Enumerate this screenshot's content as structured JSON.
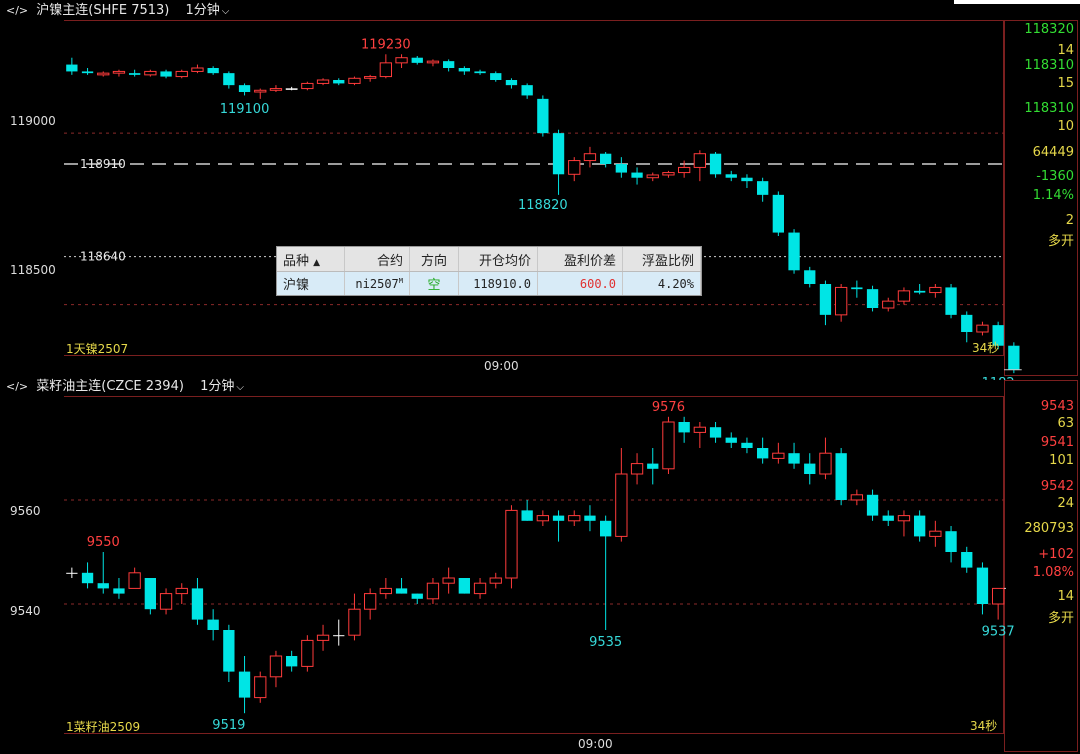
{
  "colors": {
    "up": "#ff3b3b",
    "down": "#00e5e5",
    "flat": "#ffffff",
    "frame": "#7a1f1f",
    "grid": "#8b2a2a",
    "label_red": "#ff4040",
    "label_cyan": "#36d9d9",
    "yellow": "#e6d84a",
    "green": "#33dd33"
  },
  "panel1": {
    "title": "沪镍主连(SHFE 7513)",
    "timeframe": "1分钟",
    "y_labels": [
      "119000",
      "118500"
    ],
    "ref_lines": [
      {
        "label": "118910",
        "value": 118910,
        "style": "dashed"
      },
      {
        "label": "118640",
        "value": 118640,
        "style": "dotted"
      }
    ],
    "annotations": [
      {
        "text": "119230",
        "value": 119230,
        "index": 20,
        "color": "red"
      },
      {
        "text": "119100",
        "value": 119100,
        "index": 11,
        "color": "cyan"
      },
      {
        "text": "118820",
        "value": 118820,
        "index": 30,
        "color": "cyan"
      },
      {
        "text": "1182",
        "value": 118300,
        "index": 59,
        "color": "cyan"
      }
    ],
    "time_label": "09:00",
    "bottom_left": "1天镍2507",
    "bottom_right": "34秒",
    "stats": [
      {
        "text": "118320",
        "color": "green"
      },
      {
        "text": "14",
        "color": "yellow"
      },
      {
        "text": "118310",
        "color": "green"
      },
      {
        "text": "15",
        "color": "yellow"
      },
      {
        "text": "118310",
        "color": "green"
      },
      {
        "text": "10",
        "color": "yellow"
      },
      {
        "text": "64449",
        "color": "yellow"
      },
      {
        "text": "-1360",
        "color": "green"
      },
      {
        "text": "1.14%",
        "color": "green"
      },
      {
        "text": "2",
        "color": "yellow"
      },
      {
        "text": "多开",
        "color": "yellow"
      }
    ]
  },
  "panel2": {
    "title": "菜籽油主连(CZCE 2394)",
    "timeframe": "1分钟",
    "y_labels": [
      "9560",
      "9540"
    ],
    "annotations": [
      {
        "text": "9550",
        "value": 9550,
        "index": 2,
        "color": "red"
      },
      {
        "text": "9576",
        "value": 9576,
        "index": 38,
        "color": "red"
      },
      {
        "text": "9519",
        "value": 9519,
        "index": 10,
        "color": "cyan"
      },
      {
        "text": "9535",
        "value": 9535,
        "index": 34,
        "color": "cyan"
      },
      {
        "text": "9537",
        "value": 9537,
        "index": 59,
        "color": "cyan"
      }
    ],
    "time_label": "09:00",
    "bottom_left": "1菜籽油2509",
    "bottom_right": "34秒",
    "stats": [
      {
        "text": "9543",
        "color": "red"
      },
      {
        "text": "63",
        "color": "yellow"
      },
      {
        "text": "9541",
        "color": "red"
      },
      {
        "text": "101",
        "color": "yellow"
      },
      {
        "text": "9542",
        "color": "red"
      },
      {
        "text": "24",
        "color": "yellow"
      },
      {
        "text": "280793",
        "color": "yellow"
      },
      {
        "text": "+102",
        "color": "red"
      },
      {
        "text": "1.08%",
        "color": "red"
      },
      {
        "text": "14",
        "color": "yellow"
      },
      {
        "text": "多开",
        "color": "yellow"
      }
    ]
  },
  "position_table": {
    "headers": [
      "品种",
      "合约",
      "方向",
      "开仓均价",
      "盈利价差",
      "浮盈比例"
    ],
    "sort_indicator": "▲",
    "row": {
      "variety": "沪镍",
      "contract": "ni2507",
      "contract_sup": "M",
      "direction": "空",
      "open_avg": "118910.0",
      "profit_diff": "600.0",
      "float_ratio": "4.20%"
    }
  },
  "chart_data": [
    {
      "type": "candlestick",
      "title": "沪镍主连(SHFE 7513)",
      "ylim": [
        118350,
        119330
      ],
      "y_ticks": [
        119000,
        118500
      ],
      "x_label": "09:00",
      "ohlc": [
        [
          119200,
          119220,
          119170,
          119180
        ],
        [
          119180,
          119190,
          119170,
          119175
        ],
        [
          119170,
          119180,
          119165,
          119175
        ],
        [
          119175,
          119185,
          119165,
          119180
        ],
        [
          119175,
          119185,
          119165,
          119170
        ],
        [
          119170,
          119185,
          119165,
          119180
        ],
        [
          119180,
          119185,
          119160,
          119165
        ],
        [
          119165,
          119185,
          119160,
          119180
        ],
        [
          119180,
          119200,
          119175,
          119190
        ],
        [
          119190,
          119195,
          119170,
          119175
        ],
        [
          119175,
          119180,
          119130,
          119140
        ],
        [
          119140,
          119145,
          119110,
          119120
        ],
        [
          119120,
          119130,
          119100,
          119125
        ],
        [
          119125,
          119140,
          119120,
          119130
        ],
        [
          119130,
          119135,
          119125,
          119130
        ],
        [
          119130,
          119150,
          119125,
          119145
        ],
        [
          119145,
          119160,
          119140,
          119155
        ],
        [
          119155,
          119160,
          119140,
          119145
        ],
        [
          119145,
          119165,
          119140,
          119160
        ],
        [
          119160,
          119170,
          119150,
          119165
        ],
        [
          119165,
          119230,
          119160,
          119205
        ],
        [
          119205,
          119230,
          119190,
          119220
        ],
        [
          119220,
          119225,
          119200,
          119205
        ],
        [
          119205,
          119215,
          119195,
          119210
        ],
        [
          119210,
          119215,
          119180,
          119190
        ],
        [
          119190,
          119195,
          119170,
          119180
        ],
        [
          119180,
          119185,
          119170,
          119175
        ],
        [
          119175,
          119180,
          119150,
          119155
        ],
        [
          119155,
          119160,
          119130,
          119140
        ],
        [
          119140,
          119145,
          119100,
          119110
        ],
        [
          119100,
          119110,
          118990,
          119000
        ],
        [
          119000,
          119010,
          118820,
          118880
        ],
        [
          118880,
          118930,
          118860,
          118920
        ],
        [
          118920,
          118960,
          118900,
          118940
        ],
        [
          118940,
          118945,
          118900,
          118910
        ],
        [
          118910,
          118930,
          118870,
          118885
        ],
        [
          118885,
          118900,
          118850,
          118870
        ],
        [
          118870,
          118885,
          118860,
          118878
        ],
        [
          118878,
          118890,
          118870,
          118885
        ],
        [
          118885,
          118920,
          118870,
          118900
        ],
        [
          118900,
          118950,
          118860,
          118940
        ],
        [
          118940,
          118945,
          118870,
          118880
        ],
        [
          118880,
          118890,
          118860,
          118870
        ],
        [
          118870,
          118880,
          118840,
          118860
        ],
        [
          118860,
          118870,
          118800,
          118820
        ],
        [
          118820,
          118830,
          118700,
          118710
        ],
        [
          118710,
          118720,
          118590,
          118600
        ],
        [
          118600,
          118610,
          118550,
          118560
        ],
        [
          118560,
          118570,
          118440,
          118470
        ],
        [
          118470,
          118560,
          118450,
          118550
        ],
        [
          118550,
          118570,
          118520,
          118545
        ],
        [
          118545,
          118555,
          118480,
          118490
        ],
        [
          118490,
          118520,
          118480,
          118510
        ],
        [
          118510,
          118550,
          118500,
          118540
        ],
        [
          118540,
          118560,
          118530,
          118535
        ],
        [
          118535,
          118560,
          118520,
          118550
        ],
        [
          118550,
          118560,
          118460,
          118470
        ],
        [
          118470,
          118480,
          118390,
          118420
        ],
        [
          118420,
          118450,
          118410,
          118440
        ],
        [
          118440,
          118450,
          118370,
          118380
        ],
        [
          118380,
          118390,
          118300,
          118310
        ]
      ]
    },
    {
      "type": "candlestick",
      "title": "菜籽油主连(CZCE 2394)",
      "ylim": [
        9515,
        9580
      ],
      "y_ticks": [
        9560,
        9540
      ],
      "x_label": "09:00",
      "ohlc": [
        [
          9546,
          9547,
          9545,
          9546
        ],
        [
          9546,
          9548,
          9543,
          9544
        ],
        [
          9544,
          9550,
          9542,
          9543
        ],
        [
          9543,
          9545,
          9541,
          9542
        ],
        [
          9543,
          9547,
          9543,
          9546
        ],
        [
          9545,
          9545,
          9538,
          9539
        ],
        [
          9539,
          9543,
          9538,
          9542
        ],
        [
          9542,
          9544,
          9540,
          9543
        ],
        [
          9543,
          9545,
          9536,
          9537
        ],
        [
          9537,
          9539,
          9533,
          9535
        ],
        [
          9535,
          9536,
          9525,
          9527
        ],
        [
          9527,
          9530,
          9519,
          9522
        ],
        [
          9522,
          9527,
          9521,
          9526
        ],
        [
          9526,
          9531,
          9524,
          9530
        ],
        [
          9530,
          9531,
          9527,
          9528
        ],
        [
          9528,
          9534,
          9527,
          9533
        ],
        [
          9533,
          9536,
          9531,
          9534
        ],
        [
          9534,
          9537,
          9532,
          9534
        ],
        [
          9534,
          9542,
          9533,
          9539
        ],
        [
          9539,
          9543,
          9537,
          9542
        ],
        [
          9542,
          9545,
          9541,
          9543
        ],
        [
          9543,
          9545,
          9542,
          9542
        ],
        [
          9542,
          9542,
          9540,
          9541
        ],
        [
          9541,
          9545,
          9540,
          9544
        ],
        [
          9544,
          9547,
          9542,
          9545
        ],
        [
          9545,
          9545,
          9542,
          9542
        ],
        [
          9542,
          9545,
          9541,
          9544
        ],
        [
          9544,
          9546,
          9543,
          9545
        ],
        [
          9545,
          9559,
          9543,
          9558
        ],
        [
          9558,
          9560,
          9556,
          9556
        ],
        [
          9556,
          9558,
          9555,
          9557
        ],
        [
          9557,
          9558,
          9552,
          9556
        ],
        [
          9556,
          9558,
          9555,
          9557
        ],
        [
          9557,
          9559,
          9554,
          9556
        ],
        [
          9556,
          9557,
          9535,
          9553
        ],
        [
          9553,
          9570,
          9552,
          9565
        ],
        [
          9565,
          9569,
          9563,
          9567
        ],
        [
          9567,
          9570,
          9563,
          9566
        ],
        [
          9566,
          9576,
          9565,
          9575
        ],
        [
          9575,
          9576,
          9571,
          9573
        ],
        [
          9573,
          9575,
          9570,
          9574
        ],
        [
          9574,
          9575,
          9571,
          9572
        ],
        [
          9572,
          9573,
          9570,
          9571
        ],
        [
          9571,
          9572,
          9569,
          9570
        ],
        [
          9570,
          9572,
          9567,
          9568
        ],
        [
          9568,
          9571,
          9567,
          9569
        ],
        [
          9569,
          9571,
          9566,
          9567
        ],
        [
          9567,
          9569,
          9563,
          9565
        ],
        [
          9565,
          9572,
          9564,
          9569
        ],
        [
          9569,
          9570,
          9559,
          9560
        ],
        [
          9560,
          9562,
          9559,
          9561
        ],
        [
          9561,
          9562,
          9556,
          9557
        ],
        [
          9557,
          9558,
          9555,
          9556
        ],
        [
          9556,
          9558,
          9553,
          9557
        ],
        [
          9557,
          9558,
          9552,
          9553
        ],
        [
          9553,
          9556,
          9551,
          9554
        ],
        [
          9554,
          9555,
          9548,
          9550
        ],
        [
          9550,
          9551,
          9546,
          9547
        ],
        [
          9547,
          9548,
          9538,
          9540
        ],
        [
          9540,
          9543,
          9537,
          9543
        ]
      ]
    }
  ]
}
